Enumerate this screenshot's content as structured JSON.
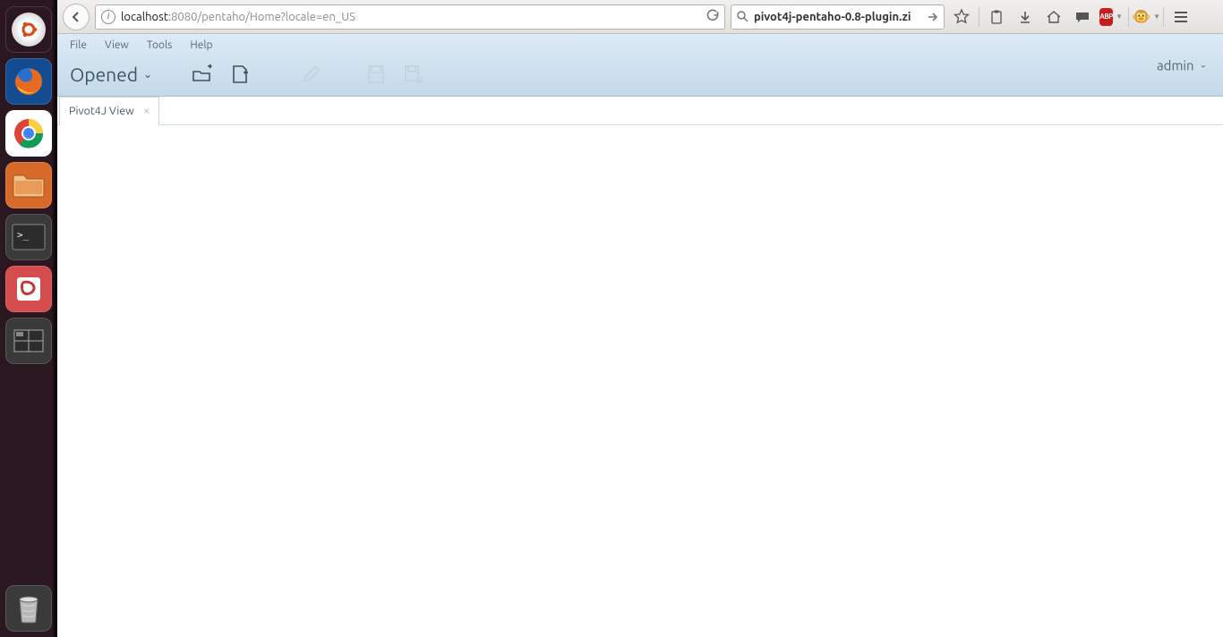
{
  "launcher": {
    "items": [
      {
        "name": "dash",
        "bg": "#2b1720"
      },
      {
        "name": "firefox",
        "bg": "#1b4c8b"
      },
      {
        "name": "chrome",
        "bg": "#ffffff"
      },
      {
        "name": "files",
        "bg": "#d66a2a"
      },
      {
        "name": "terminal",
        "bg": "#3a3a3a"
      },
      {
        "name": "reader",
        "bg": "#d44c4c"
      },
      {
        "name": "workspace",
        "bg": "#3a3a3a"
      }
    ]
  },
  "browser": {
    "url_host": "localhost",
    "url_rest": ":8080/pentaho/Home?locale=en_US",
    "search_text": "pivot4j-pentaho-0.8-plugin.zi",
    "abp_label": "ABP"
  },
  "pentaho": {
    "menu": {
      "file": "File",
      "view": "View",
      "tools": "Tools",
      "help": "Help"
    },
    "opened_label": "Opened",
    "user_label": "admin",
    "tab_label": "Pivot4J View"
  }
}
